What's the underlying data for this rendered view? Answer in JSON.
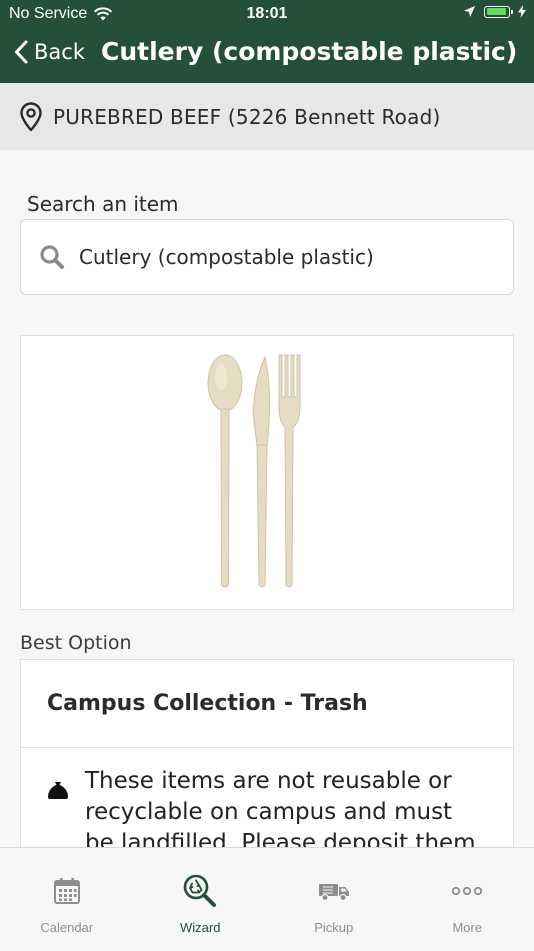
{
  "status_bar": {
    "carrier": "No Service",
    "time": "18:01"
  },
  "nav": {
    "back_label": "Back",
    "title": "Cutlery (compostable plastic)"
  },
  "location": {
    "text": "PUREBRED BEEF (5226 Bennett Road)"
  },
  "search": {
    "label": "Search an item",
    "value": "Cutlery (compostable plastic)"
  },
  "result": {
    "section_label": "Best Option",
    "title": "Campus Collection - Trash",
    "description": "These items are not reusable or recyclable on campus and must be landfilled. Please deposit them in a trash bin."
  },
  "tabs": [
    {
      "label": "Calendar",
      "icon": "calendar-icon",
      "active": false
    },
    {
      "label": "Wizard",
      "icon": "wizard-search-icon",
      "active": true
    },
    {
      "label": "Pickup",
      "icon": "truck-icon",
      "active": false
    },
    {
      "label": "More",
      "icon": "more-icon",
      "active": false
    }
  ],
  "colors": {
    "brand": "#245039",
    "background": "#f5f8f7",
    "inactive_tab": "#8e8e8e"
  }
}
